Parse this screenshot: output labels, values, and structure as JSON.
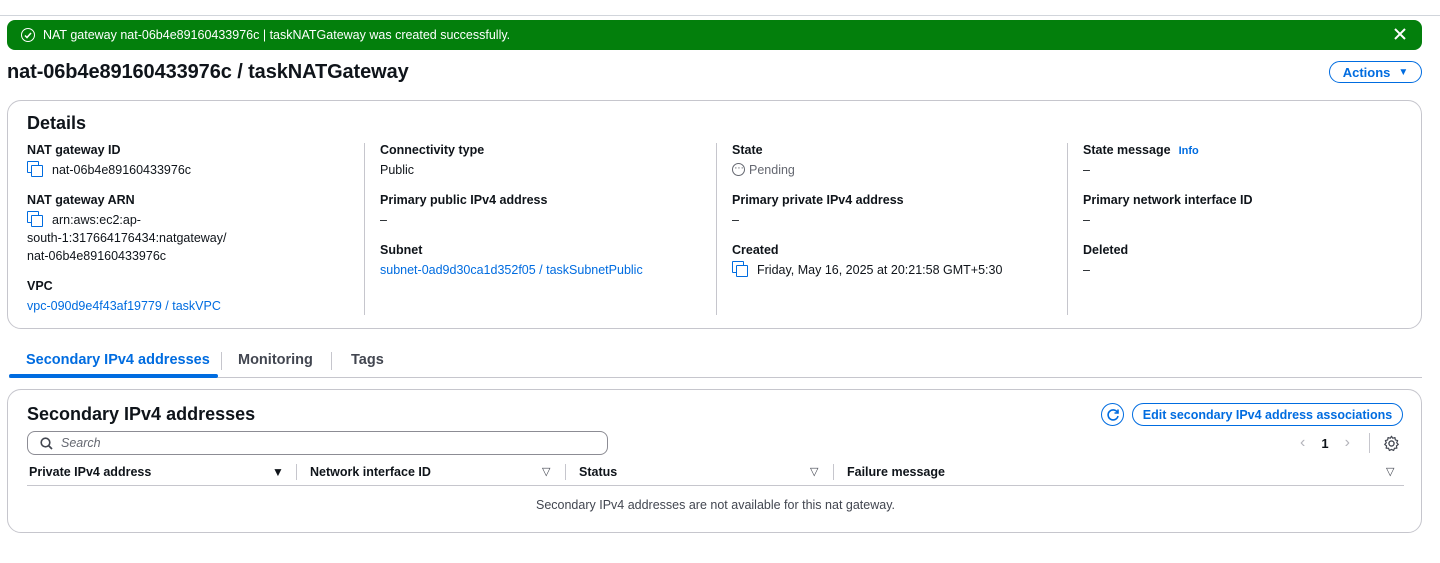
{
  "flash": {
    "message": "NAT gateway nat-06b4e89160433976c | taskNATGateway was created successfully.",
    "icon": "check-circle-icon",
    "close_icon": "close-icon",
    "color": "#037f0c"
  },
  "page": {
    "title": "nat-06b4e89160433976c / taskNATGateway",
    "actions_label": "Actions"
  },
  "details": {
    "title": "Details",
    "nat_gateway_id": {
      "label": "NAT gateway ID",
      "value": "nat-06b4e89160433976c"
    },
    "nat_gateway_arn": {
      "label": "NAT gateway ARN",
      "line1": "arn:aws:ec2:ap-",
      "line2": "south-1:317664176434:natgateway/",
      "line3": "nat-06b4e89160433976c"
    },
    "vpc": {
      "label": "VPC",
      "value": "vpc-090d9e4f43af19779 / taskVPC"
    },
    "connectivity_type": {
      "label": "Connectivity type",
      "value": "Public"
    },
    "primary_public_ipv4": {
      "label": "Primary public IPv4 address",
      "value": "–"
    },
    "subnet": {
      "label": "Subnet",
      "value": "subnet-0ad9d30ca1d352f05 / taskSubnetPublic"
    },
    "state": {
      "label": "State",
      "value": "Pending"
    },
    "primary_private_ipv4": {
      "label": "Primary private IPv4 address",
      "value": "–"
    },
    "created": {
      "label": "Created",
      "value": "Friday, May 16, 2025 at 20:21:58 GMT+5:30"
    },
    "state_message": {
      "label": "State message",
      "info": "Info",
      "value": "–"
    },
    "primary_network_interface_id": {
      "label": "Primary network interface ID",
      "value": "–"
    },
    "deleted": {
      "label": "Deleted",
      "value": "–"
    }
  },
  "tabs": [
    {
      "label": "Secondary IPv4 addresses",
      "active": true
    },
    {
      "label": "Monitoring",
      "active": false
    },
    {
      "label": "Tags",
      "active": false
    }
  ],
  "secondary": {
    "title": "Secondary IPv4 addresses",
    "edit_label": "Edit secondary IPv4 address associations",
    "search_placeholder": "Search",
    "page_number": "1",
    "columns": [
      "Private IPv4 address",
      "Network interface ID",
      "Status",
      "Failure message"
    ],
    "empty_message": "Secondary IPv4 addresses are not available for this nat gateway."
  },
  "colors": {
    "accent": "#006ce0",
    "success": "#037f0c",
    "border": "#c6c6cd"
  }
}
